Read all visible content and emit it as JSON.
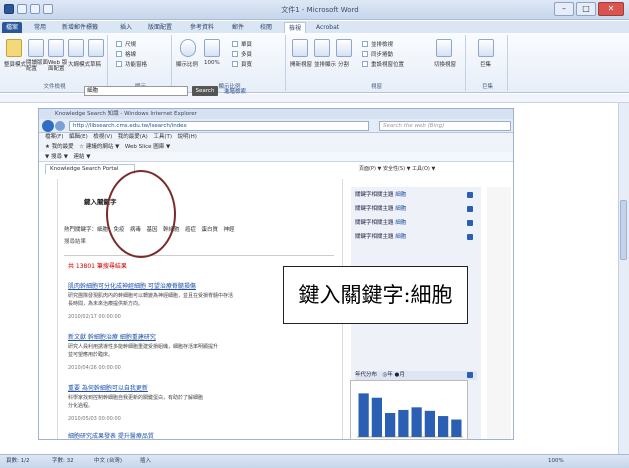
{
  "window": {
    "title": "文件1 - Microsoft Word",
    "controls": {
      "minimize": "–",
      "maximize": "□",
      "close": "✕"
    }
  },
  "ribbon": {
    "tabs": [
      "檔案",
      "常用",
      "新增郵件標籤",
      "插入",
      "版面配置",
      "參考資料",
      "郵件",
      "校閱",
      "檢視",
      "Acrobat"
    ],
    "active_tab": "檢視",
    "groups": [
      {
        "name": "文件檢視",
        "buttons": [
          "整頁模式",
          "閱讀版面配置",
          "Web 版面配置",
          "大綱模式",
          "草稿"
        ]
      },
      {
        "name": "顯示",
        "buttons": [
          "尺規",
          "格線",
          "功能窗格"
        ]
      },
      {
        "name": "顯示比例",
        "buttons": [
          "顯示比例",
          "100%",
          "單頁",
          "多頁",
          "頁寬"
        ]
      },
      {
        "name": "視窗",
        "buttons": [
          "開新視窗",
          "並排顯示",
          "分割",
          "並排檢視",
          "同步捲動",
          "重設視窗位置",
          "切換視窗"
        ]
      },
      {
        "name": "巨集",
        "buttons": [
          "巨集"
        ]
      }
    ]
  },
  "browser": {
    "title": "Knowledge Search 知識 - Windows Internet Explorer",
    "address": "http://libsearch.cms.edu.tw/lsearch/index",
    "search_placeholder": "Search the web (Bing)",
    "menu": "檔案(F)　編輯(E)　檢視(V)　我的最愛(A)　工具(T)　說明(H)",
    "favorites": "★ 我的最愛　☆ 建議的網站 ▼　Web Slice 圖庫 ▼",
    "toolbar2": "▼ 搜尋 ▼　連結 ▼",
    "tab": "Knowledge Search Portal",
    "tools": "頁面(P) ▼ 安全性(S) ▼ 工具(O) ▼"
  },
  "page": {
    "keyword_label": "鍵入關鍵字",
    "keyword_value": "細胞",
    "search_button": "Search",
    "advanced": "進階檢索",
    "filters": "熱門關鍵字：細胞　免疫　病毒　基因　幹細胞　癌症　蛋白質　神經",
    "result_heading": "搜尋結果",
    "result_count": "共 13801 筆搜尋結果",
    "results": [
      {
        "title": "肌肉幹細胞可分化成神經細胞 可望治療脊髓損傷",
        "line1": "研究團隊發現肌肉內的幹細胞可以轉變為神經細胞，並且在受損脊髓中存活",
        "line2": "長時間，為未來治療提供新方向。",
        "date": "2010/02/17 00:00:00"
      },
      {
        "title": "新文獻 幹細胞治療 細胞重建研究",
        "line1": "研究人員利用誘導性多能幹細胞重建受損組織，細胞存活率明顯提升",
        "line2": "並可望應用於臨床。",
        "date": "2010/04/26 00:00:00"
      },
      {
        "title": "重要 為何幹細胞可以自我更新",
        "line1": "科學家找到控制幹細胞自我更新的關鍵蛋白，有助於了解細胞",
        "line2": "分化過程。",
        "date": "2010/05/03 00:00:00"
      },
      {
        "title": "細胞研究成果發表 提升醫療品質",
        "line1": "",
        "line2": "",
        "date": ""
      }
    ]
  },
  "sidebar": {
    "rows": [
      {
        "label": "關鍵字相關主題",
        "link": "細胞"
      },
      {
        "label": "關鍵字相關主題",
        "link": "細胞"
      },
      {
        "label": "關鍵字相關主題",
        "link": "細胞"
      },
      {
        "label": "關鍵字相關主題",
        "link": "細胞"
      }
    ],
    "chart_header": "年代分布　◎年 ●月"
  },
  "annotation": {
    "callout": "鍵入關鍵字:細胞"
  },
  "chart_data": {
    "type": "bar",
    "categories": [
      "1",
      "2",
      "3",
      "4",
      "5",
      "6",
      "7",
      "8"
    ],
    "values": [
      100,
      90,
      55,
      62,
      68,
      60,
      48,
      40
    ],
    "title": "",
    "xlabel": "",
    "ylabel": "",
    "ylim": [
      0,
      110
    ]
  },
  "statusbar": {
    "page": "頁數: 1/2",
    "words": "字數: 32",
    "lang": "中文 (台灣)",
    "mode": "插入",
    "zoom": "100%"
  },
  "colors": {
    "accent": "#2b579a",
    "bar": "#2b5fb3",
    "annotation_circle": "#7a2b2b"
  }
}
